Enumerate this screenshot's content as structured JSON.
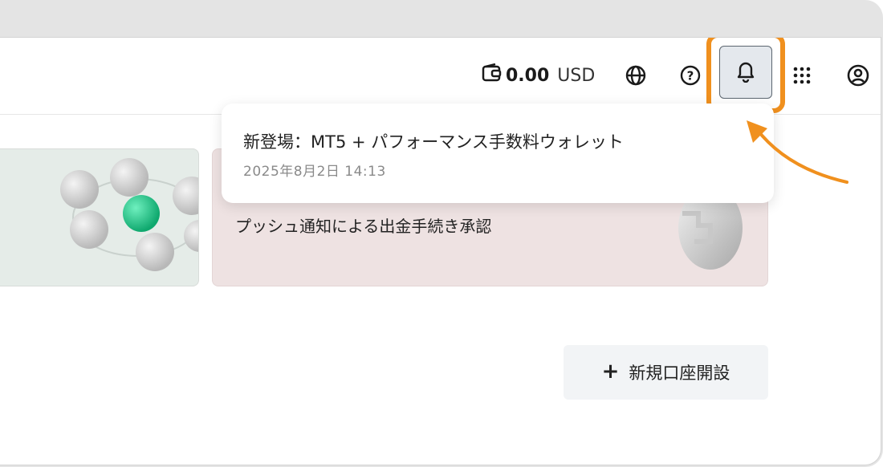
{
  "header": {
    "balance_amount": "0.00",
    "balance_currency": "USD",
    "icons": [
      "wallet-icon",
      "globe-icon",
      "help-icon",
      "bell-icon",
      "apps-grid-icon",
      "account-icon"
    ]
  },
  "notification": {
    "title": "新登場：MT5 + パフォーマンス手数料ウォレット",
    "date": "2025年8月2日 14:13"
  },
  "cards": {
    "pink_text": "プッシュ通知による出金手続き承認"
  },
  "actions": {
    "new_account_label": "新規口座開設",
    "plus_symbol": "+"
  },
  "colors": {
    "highlight": "#f0901e",
    "green_sphere": "#16c985",
    "bell_bg": "#e4e8ed"
  }
}
